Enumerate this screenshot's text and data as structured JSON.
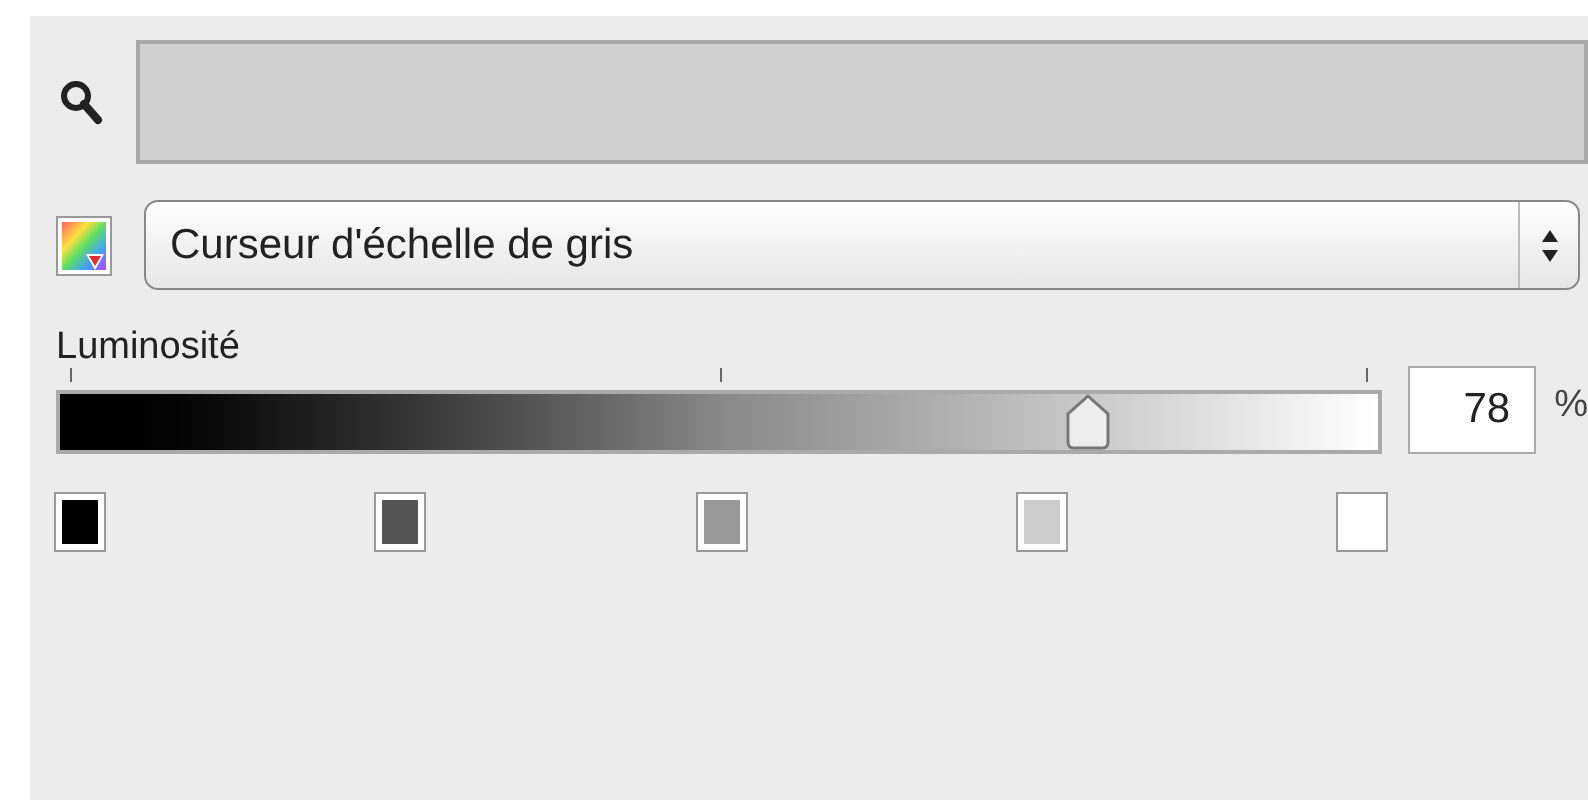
{
  "picker": {
    "label": "Curseur d'échelle de gris"
  },
  "brightness": {
    "label": "Luminosité",
    "level": 0.78,
    "value": "78",
    "unit": "%"
  },
  "swatches": [
    {
      "color": "#000000"
    },
    {
      "color": "#555555"
    },
    {
      "color": "#999999"
    },
    {
      "color": "#cccccc"
    },
    {
      "color": "#ffffff"
    }
  ]
}
